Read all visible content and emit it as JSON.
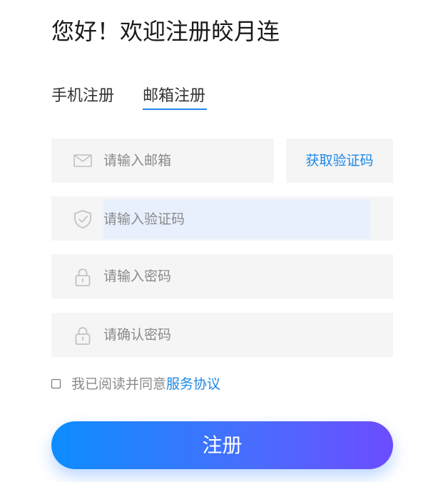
{
  "title": "您好！欢迎注册皎月连",
  "tabs": [
    {
      "label": "手机注册",
      "active": false
    },
    {
      "label": "邮箱注册",
      "active": true
    }
  ],
  "form": {
    "email": {
      "placeholder": "请输入邮箱",
      "value": "",
      "icon": "mail-icon"
    },
    "get_code_label": "获取验证码",
    "code": {
      "placeholder": "请输入验证码",
      "value": "",
      "icon": "shield-check-icon"
    },
    "password": {
      "placeholder": "请输入密码",
      "value": "",
      "icon": "lock-icon"
    },
    "confirm_password": {
      "placeholder": "请确认密码",
      "value": "",
      "icon": "lock-icon"
    }
  },
  "agreement": {
    "checked": false,
    "text": "我已阅读并同意",
    "link_label": "服务协议"
  },
  "submit_label": "注册",
  "colors": {
    "accent": "#1e88e5",
    "field_bg": "#f5f5f5",
    "focused_field_bg": "#e8effd",
    "button_gradient_start": "#0d8dff",
    "button_gradient_end": "#6d4cff"
  }
}
